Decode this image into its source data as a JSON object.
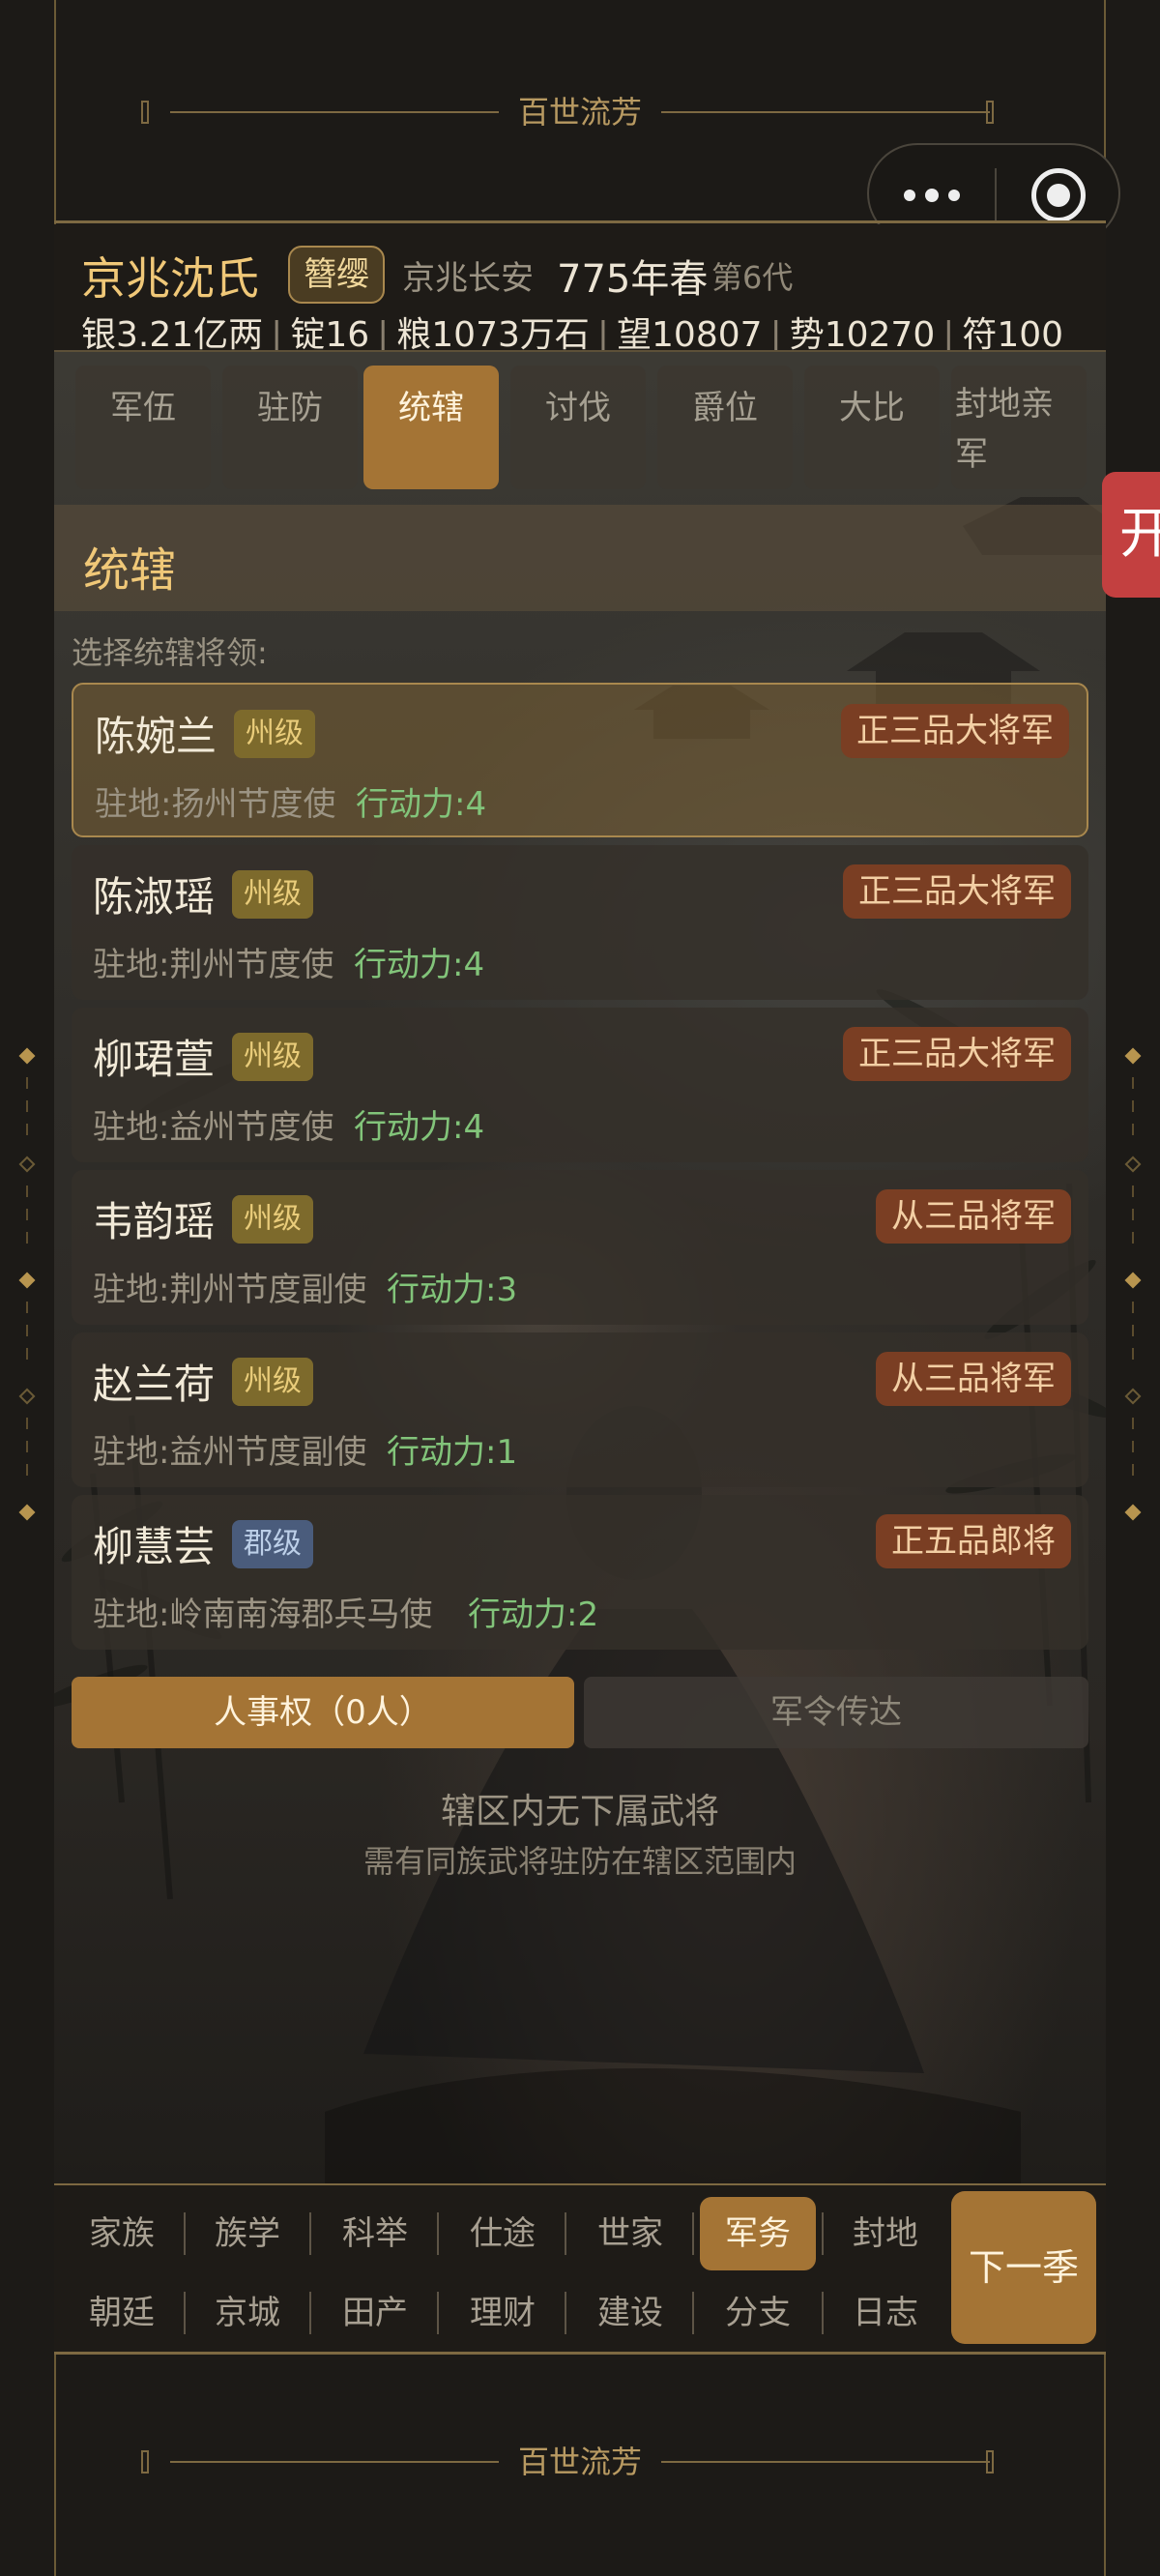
{
  "brand": {
    "title": "百世流芳"
  },
  "header": {
    "family_name": "京兆沈氏",
    "rank": "簪缨",
    "location": "京兆长安",
    "season": "775年春",
    "generation": "第6代",
    "resources": [
      "银3.21亿两",
      "锭16",
      "粮1073万石",
      "望10807",
      "势10270",
      "符100"
    ]
  },
  "tabs": [
    {
      "label": "军伍"
    },
    {
      "label": "驻防"
    },
    {
      "label": "统辖"
    },
    {
      "label": "讨伐"
    },
    {
      "label": "爵位"
    },
    {
      "label": "大比"
    },
    {
      "label": "封地亲军"
    }
  ],
  "section": {
    "title": "统辖",
    "prompt": "选择统辖将领:"
  },
  "generals": [
    {
      "name": "陈婉兰",
      "level": "州级",
      "title": "正三品大将军",
      "garrison": "驻地:扬州节度使",
      "action": "行动力:4"
    },
    {
      "name": "陈淑瑶",
      "level": "州级",
      "title": "正三品大将军",
      "garrison": "驻地:荆州节度使",
      "action": "行动力:4"
    },
    {
      "name": "柳珺萱",
      "level": "州级",
      "title": "正三品大将军",
      "garrison": "驻地:益州节度使",
      "action": "行动力:4"
    },
    {
      "name": "韦韵瑶",
      "level": "州级",
      "title": "从三品将军",
      "garrison": "驻地:荆州节度副使",
      "action": "行动力:3"
    },
    {
      "name": "赵兰荷",
      "level": "州级",
      "title": "从三品将军",
      "garrison": "驻地:益州节度副使",
      "action": "行动力:1"
    },
    {
      "name": "柳慧芸",
      "level": "郡级",
      "title": "正五品郎将",
      "garrison": "驻地:岭南南海郡兵马使",
      "action": "行动力:2"
    }
  ],
  "sub_tabs": {
    "personnel": "人事权（0人）",
    "orders": "军令传达"
  },
  "empty_state": {
    "line1": "辖区内无下属武将",
    "line2": "需有同族武将驻防在辖区范围内"
  },
  "side_tab": {
    "label": "开"
  },
  "bottom_nav": {
    "row1": [
      "家族",
      "族学",
      "科举",
      "仕途",
      "世家",
      "军务",
      "封地"
    ],
    "row2": [
      "朝廷",
      "京城",
      "田产",
      "理财",
      "建设",
      "分支",
      "日志"
    ],
    "next_button": "下一季"
  },
  "colors": {
    "accent": "#a47435",
    "gold_text": "#f0c878",
    "action_green": "#82c47a",
    "title_badge": "#7a3e23",
    "side_tab": "#c34040"
  }
}
